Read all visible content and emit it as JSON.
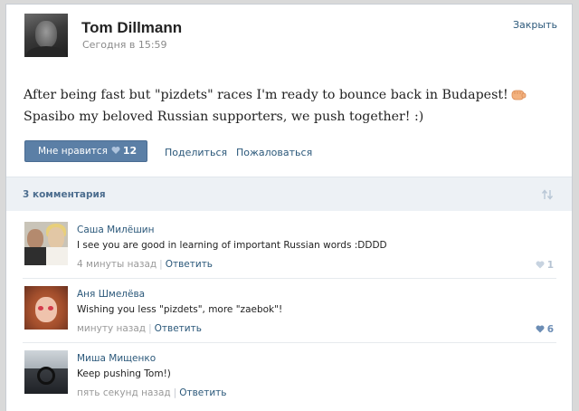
{
  "post": {
    "author": "Tom Dillmann",
    "time": "Сегодня в 15:59",
    "close_label": "Закрыть",
    "text_line1": "After being fast but \"pizdets\" races I'm ready to bounce back in Budapest!",
    "text_line2": "Spasibo my beloved Russian supporters, we push together! :)",
    "like_label": "Мне нравится",
    "like_count": "12",
    "share_label": "Поделиться",
    "report_label": "Пожаловаться"
  },
  "comments_header": {
    "count_label": "3 комментария"
  },
  "comments": [
    {
      "author": "Саша Милёшин",
      "text": "I see you are good in learning of important Russian words :DDDD",
      "time": "4 минуты назад",
      "reply": "Ответить",
      "likes": "1"
    },
    {
      "author": "Аня Шмелёва",
      "text": "Wishing you less \"pizdets\", more \"zaebok\"!",
      "time": "минуту назад",
      "reply": "Ответить",
      "likes": "6"
    },
    {
      "author": "Миша Мищенко",
      "text": "Keep pushing Tom!)",
      "time": "пять секунд назад",
      "reply": "Ответить"
    }
  ],
  "colors": {
    "link": "#2b587a",
    "button": "#5b7fa6",
    "header_bg": "#edf1f5",
    "like_active": "#6c8db5"
  },
  "icons": [
    "heart-icon",
    "fist-emoji-icon",
    "sort-icon"
  ]
}
